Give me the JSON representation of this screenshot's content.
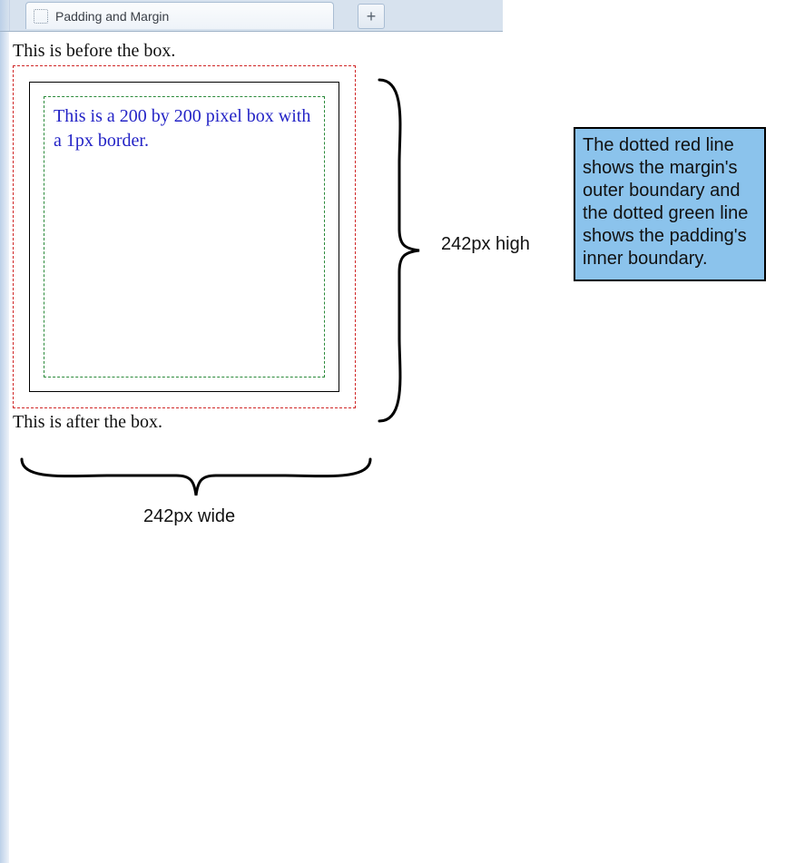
{
  "tab": {
    "title": "Padding and Margin"
  },
  "document": {
    "before_text": "This is before the box.",
    "box_text": "This is a 200 by 200 pixel box with a 1px border.",
    "after_text": "This is after the box."
  },
  "annotations": {
    "height_label": "242px high",
    "width_label": "242px wide",
    "callout_text": "The dotted red line shows the margin's outer boundary and the dotted green line shows the padding's inner boundary."
  }
}
